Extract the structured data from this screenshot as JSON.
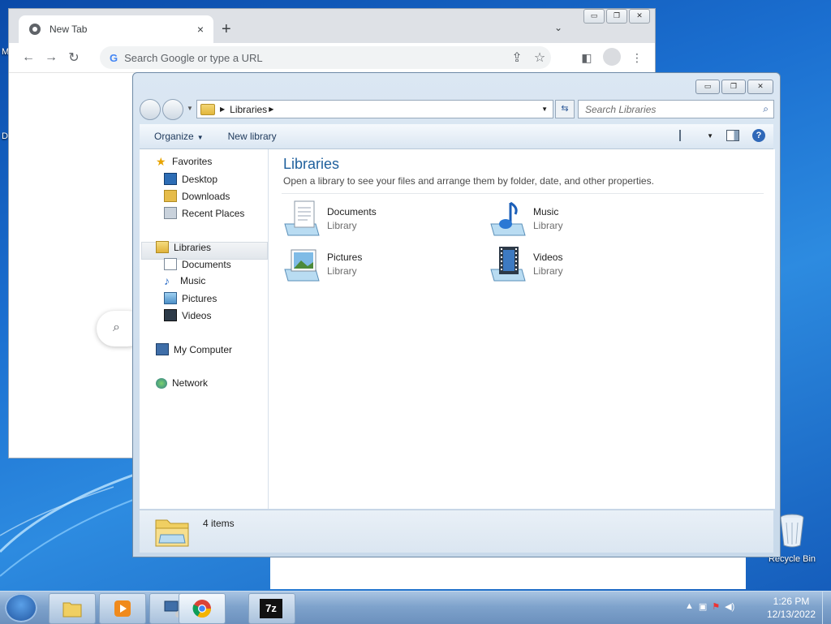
{
  "desktop": {
    "left_labels": [
      "M",
      "D"
    ],
    "recycle_bin": "Recycle Bin"
  },
  "chrome": {
    "tab_title": "New Tab",
    "tab_close": "×",
    "new_tab": "+",
    "tab_search": "⌄",
    "omnibox_placeholder": "Search Google or type a URL",
    "omnibox_g": "G",
    "window_buttons": [
      "▭",
      "❐",
      "✕"
    ],
    "search_icon": "⌕"
  },
  "explorer": {
    "window_buttons": [
      "▭",
      "❐",
      "✕"
    ],
    "address_path": "Libraries",
    "search_placeholder": "Search Libraries",
    "toolbar": {
      "organize": "Organize",
      "new_library": "New library",
      "help": "?"
    },
    "nav": {
      "favorites": "Favorites",
      "desktop": "Desktop",
      "downloads": "Downloads",
      "recent": "Recent Places",
      "libraries": "Libraries",
      "documents": "Documents",
      "music": "Music",
      "pictures": "Pictures",
      "videos": "Videos",
      "computer": "My Computer",
      "network": "Network"
    },
    "content": {
      "title": "Libraries",
      "description": "Open a library to see your files and arrange them by folder, date, and other properties.",
      "items": [
        {
          "name": "Documents",
          "type": "Library"
        },
        {
          "name": "Music",
          "type": "Library"
        },
        {
          "name": "Pictures",
          "type": "Library"
        },
        {
          "name": "Videos",
          "type": "Library"
        }
      ]
    },
    "details": {
      "count": "4 items"
    }
  },
  "taskbar": {
    "time": "1:26 PM",
    "date": "12/13/2022",
    "sevenzip": "7z"
  }
}
